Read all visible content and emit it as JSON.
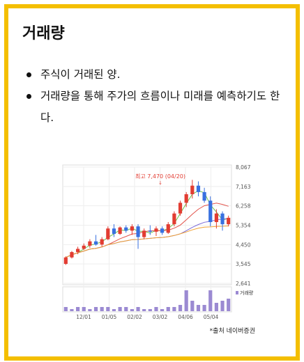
{
  "title": "거래량",
  "bullets": [
    "주식이 거래된 양.",
    "거래량을 통해 주가의 흐름이나 미래를 예측하기도 한다."
  ],
  "source_note": "*출처 네이버증권",
  "colors": {
    "frame": "#f4bf00",
    "up": "#e23c32",
    "down": "#3870e0",
    "volume": "#9b8ad2"
  },
  "chart_data": {
    "type": "candlestick",
    "annotation": "최고 7,470 (04/20)",
    "y_ticks": [
      "8,067",
      "7,163",
      "6,258",
      "5,354",
      "4,450",
      "3,545",
      "2,641"
    ],
    "ylim": [
      2641,
      8067
    ],
    "x_ticks": [
      "12/01",
      "01/05",
      "02/02",
      "03/02",
      "04/06",
      "05/04"
    ],
    "volume_label": "거래량",
    "candles": [
      {
        "o": 3550,
        "h": 3900,
        "l": 3500,
        "c": 3850
      },
      {
        "o": 3850,
        "h": 4150,
        "l": 3800,
        "c": 4100
      },
      {
        "o": 4100,
        "h": 4350,
        "l": 4000,
        "c": 4250
      },
      {
        "o": 4250,
        "h": 4500,
        "l": 4200,
        "c": 4400
      },
      {
        "o": 4400,
        "h": 4700,
        "l": 4300,
        "c": 4600
      },
      {
        "o": 4600,
        "h": 4900,
        "l": 4400,
        "c": 4450
      },
      {
        "o": 4450,
        "h": 4800,
        "l": 4350,
        "c": 4700
      },
      {
        "o": 4700,
        "h": 5300,
        "l": 4650,
        "c": 5200
      },
      {
        "o": 5200,
        "h": 5400,
        "l": 4800,
        "c": 4950
      },
      {
        "o": 4950,
        "h": 5300,
        "l": 4900,
        "c": 5250
      },
      {
        "o": 5250,
        "h": 5350,
        "l": 5000,
        "c": 5100
      },
      {
        "o": 5100,
        "h": 5400,
        "l": 4900,
        "c": 5300
      },
      {
        "o": 5300,
        "h": 5400,
        "l": 4250,
        "c": 4800
      },
      {
        "o": 4800,
        "h": 5200,
        "l": 4700,
        "c": 5100
      },
      {
        "o": 5100,
        "h": 5350,
        "l": 4900,
        "c": 5050
      },
      {
        "o": 5050,
        "h": 5300,
        "l": 4850,
        "c": 5200
      },
      {
        "o": 5200,
        "h": 5300,
        "l": 4900,
        "c": 5000
      },
      {
        "o": 5000,
        "h": 5500,
        "l": 4950,
        "c": 5400
      },
      {
        "o": 5400,
        "h": 6000,
        "l": 5300,
        "c": 5900
      },
      {
        "o": 5900,
        "h": 6500,
        "l": 5800,
        "c": 6400
      },
      {
        "o": 6400,
        "h": 6900,
        "l": 6200,
        "c": 6800
      },
      {
        "o": 6800,
        "h": 7470,
        "l": 6600,
        "c": 7200
      },
      {
        "o": 7200,
        "h": 7400,
        "l": 6700,
        "c": 6900
      },
      {
        "o": 6900,
        "h": 7100,
        "l": 6400,
        "c": 6500
      },
      {
        "o": 6500,
        "h": 6700,
        "l": 5300,
        "c": 5500
      },
      {
        "o": 5500,
        "h": 6100,
        "l": 5200,
        "c": 5900
      },
      {
        "o": 5900,
        "h": 6000,
        "l": 5100,
        "c": 5400
      },
      {
        "o": 5400,
        "h": 5800,
        "l": 5300,
        "c": 5700
      }
    ],
    "volumes": [
      2,
      1,
      2,
      2,
      1,
      2,
      2,
      2,
      1,
      2,
      2,
      1,
      2,
      1,
      1,
      2,
      1,
      2,
      2,
      3,
      10,
      5,
      3,
      3,
      10,
      4,
      5,
      6
    ]
  }
}
